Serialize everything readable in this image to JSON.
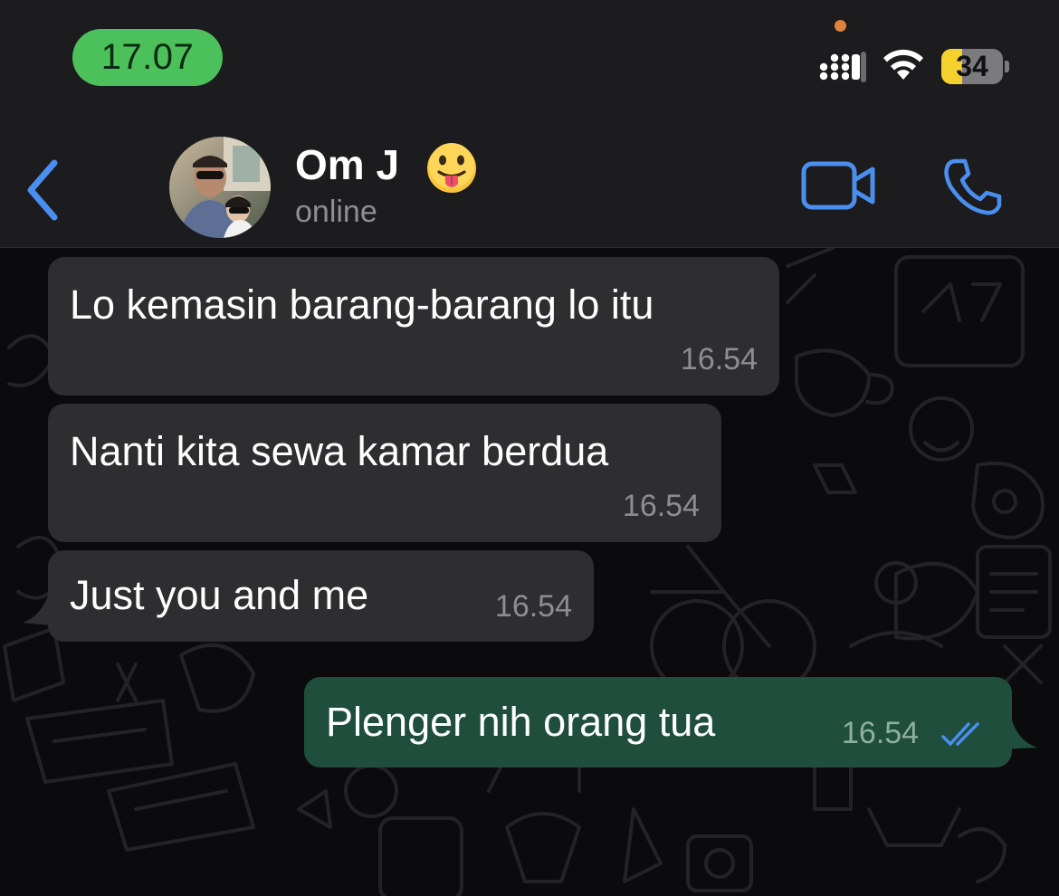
{
  "status_bar": {
    "time": "17.07",
    "battery_level": "34",
    "battery_percent": 34
  },
  "header": {
    "contact_name": "Om J",
    "contact_emoji": "😛",
    "status": "online"
  },
  "messages": [
    {
      "direction": "incoming",
      "text": "Lo kemasin barang-barang lo itu",
      "time": "16.54"
    },
    {
      "direction": "incoming",
      "text": "Nanti kita sewa kamar berdua",
      "time": "16.54"
    },
    {
      "direction": "incoming",
      "text": "Just you and me",
      "time": "16.54"
    },
    {
      "direction": "outgoing",
      "text": "Plenger nih orang tua",
      "time": "16.54",
      "read_receipt": "double-check-icon"
    }
  ],
  "colors": {
    "accent_blue": "#4a8ff0",
    "incoming_bubble": "#2e2e30",
    "outgoing_bubble": "#1f4e3d",
    "time_pill": "#4cc05a"
  }
}
